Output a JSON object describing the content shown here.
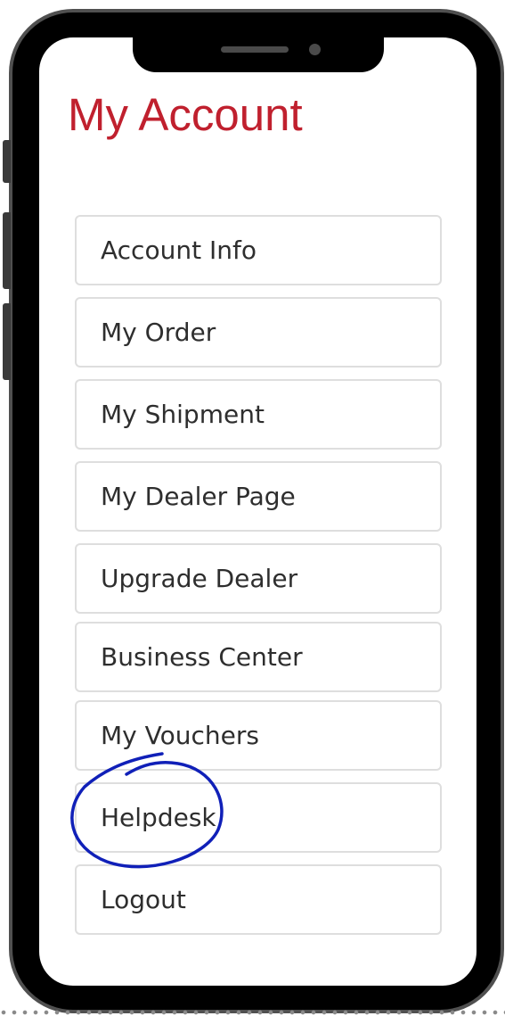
{
  "header": {
    "title": "My Account"
  },
  "menu": {
    "items": [
      {
        "label": "Account Info"
      },
      {
        "label": "My Order"
      },
      {
        "label": "My Shipment"
      },
      {
        "label": "My Dealer Page"
      },
      {
        "label": "Upgrade Dealer"
      },
      {
        "label": "Business Center"
      },
      {
        "label": "My Vouchers"
      },
      {
        "label": "Helpdesk"
      },
      {
        "label": "Logout"
      }
    ]
  },
  "colors": {
    "title": "#c0202e",
    "annotation": "#1020b8",
    "frame": "#000000",
    "item_border": "#dedede"
  },
  "icons": {
    "annotation_mark": "hand-drawn-circle"
  }
}
